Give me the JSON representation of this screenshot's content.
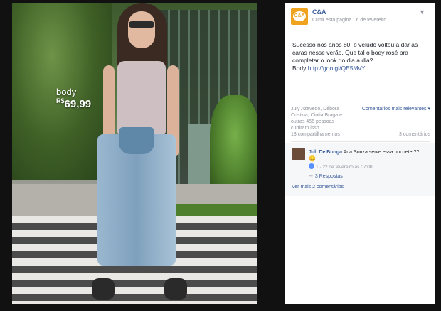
{
  "photo": {
    "price_tag": {
      "name": "body",
      "currency": "R$",
      "value": "69,99"
    }
  },
  "post": {
    "page_name": "C&A",
    "logo_text": "C&A",
    "follow_label": "Curtir esta página",
    "date": "6 de fevereiro",
    "text_lines": [
      "Sucesso nos anos 80, o veludo voltou a dar as",
      "caras nesse verão. Que tal o body rosé pra",
      "completar o look do dia a dia?"
    ],
    "text_link_label": "Body",
    "text_link_url": "http://goo.gl/QE5MvY",
    "reactions_names": "July Azevedo, Débora Cristina, Cintia Braga e outras 456 pessoas curtiram isso.",
    "sort_label": "Comentários mais relevantes ▾",
    "shares": "13 compartilhamentos",
    "comments_count": "3 comentários",
    "comment": {
      "author": "Juh De Bonga",
      "text": "Ana Souza serve essa pochete ??",
      "emoji": "😊",
      "meta": "1 · 22 de fevereiro às 07:00",
      "replies": "3 Respostas"
    },
    "more_comments": "Ver mais 2 comentários"
  }
}
